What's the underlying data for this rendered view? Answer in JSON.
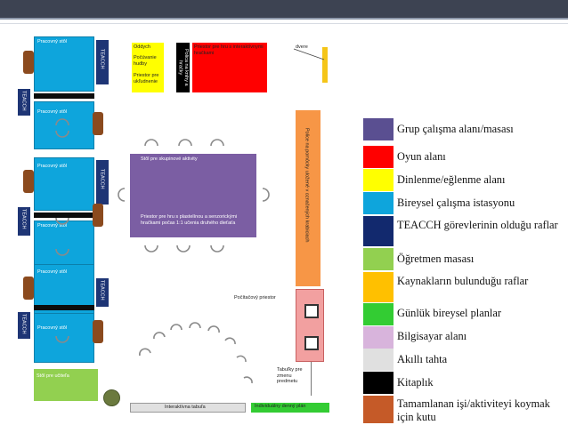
{
  "plan": {
    "workstations": [
      {
        "label": "Pracovný stôl",
        "teacch": "TEACCH"
      },
      {
        "label": "Pracovný stôl",
        "teacch": "TEACCH"
      },
      {
        "label": "Pracovný stôl",
        "teacch": "TEACCH"
      },
      {
        "label": "Pracovný stôl",
        "teacch": "TEACCH"
      },
      {
        "label": "Pracovný stôl",
        "teacch": "TEACCH"
      },
      {
        "label": "Pracovný stôl",
        "teacch": "TEACCH"
      }
    ],
    "relax": {
      "line1": "Oddych",
      "line2": "Počúvanie hudby",
      "line3": "Priestor pre ukľudnenie"
    },
    "shelf_books": "Polica na knihy a hračky",
    "play_zone": "Priestor pre hru s interaktívnymi hračkami",
    "door": "dvere",
    "group_table": {
      "title": "Stôl pre skupinové aktivity",
      "sub": "Priestor pre hru s plastelínou a senzorickými hračkami počas 1:1 učenia druhého dieťaťa"
    },
    "resources_shelf": "Police na pomôcky uložené v označených krabiciach",
    "computer": "Počítačový priestor",
    "finished_boxes": "Tabuľky pre zmenu predmetu",
    "teacher_table": "Stôl pre učiteľa",
    "interactive_board": "Interaktívna tabuľa",
    "schedule": "Individuálny denný plán"
  },
  "legend": [
    {
      "color": "#5a4f91",
      "text": "Grup çalışma alanı/masası"
    },
    {
      "color": "#ff0000",
      "text": "Oyun alanı"
    },
    {
      "color": "#ffff00",
      "text": "Dinlenme/eğlenme alanı"
    },
    {
      "color": "#0ea5dc",
      "text": "Bireysel çalışma istasyonu"
    },
    {
      "color": "#12296e",
      "text": "TEACCH görevlerinin olduğu raflar"
    },
    {
      "color": "#92d050",
      "text": "Öğretmen masası"
    },
    {
      "color": "#ffc000",
      "text": "Kaynakların bulunduğu raflar"
    },
    {
      "color": "#33cc33",
      "text": "Günlük bireysel planlar"
    },
    {
      "color": "#d8b4dc",
      "text": "Bilgisayar alanı"
    },
    {
      "color": "#e0e0e0",
      "text": "Akıllı tahta"
    },
    {
      "color": "#000000",
      "text": "Kitaplık"
    },
    {
      "color": "#c55a28",
      "text": "Tamamlanan işi/aktiviteyi koymak için kutu"
    }
  ]
}
